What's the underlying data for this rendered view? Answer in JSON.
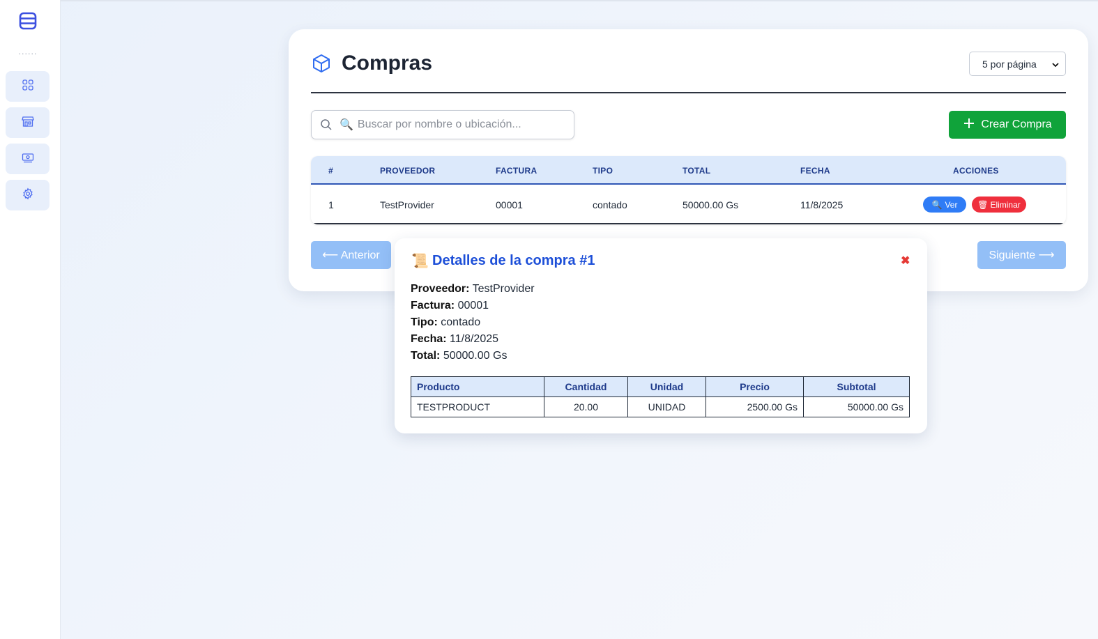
{
  "sidebar": {
    "dots": "......",
    "items": [
      {
        "name": "dashboard"
      },
      {
        "name": "store"
      },
      {
        "name": "cash"
      },
      {
        "name": "settings"
      }
    ]
  },
  "header": {
    "title": "Compras",
    "per_page": "5 por página",
    "per_page_options": [
      "5 por página"
    ]
  },
  "search": {
    "emoji": "🔍",
    "placeholder": "Buscar por nombre o ubicación..."
  },
  "actions": {
    "create_label": "Crear Compra"
  },
  "table": {
    "columns": [
      "#",
      "PROVEEDOR",
      "FACTURA",
      "TIPO",
      "TOTAL",
      "FECHA",
      "ACCIONES"
    ],
    "rows": [
      {
        "num": "1",
        "proveedor": "TestProvider",
        "factura": "00001",
        "tipo": "contado",
        "total": "50000.00 Gs",
        "fecha": "11/8/2025"
      }
    ],
    "ver_label": "Ver",
    "ver_emoji": "🔍",
    "eliminar_label": "Eliminar",
    "eliminar_emoji": "🗑"
  },
  "pagination": {
    "prev_label": "⟵ Anterior",
    "next_label": "Siguiente ⟶"
  },
  "modal": {
    "icon": "📜",
    "title": "Detalles de la compra #1",
    "close": "✖",
    "fields": [
      {
        "label": "Proveedor:",
        "value": "TestProvider"
      },
      {
        "label": "Factura:",
        "value": "00001"
      },
      {
        "label": "Tipo:",
        "value": "contado"
      },
      {
        "label": "Fecha:",
        "value": "11/8/2025"
      },
      {
        "label": "Total:",
        "value": "50000.00 Gs"
      }
    ],
    "table": {
      "columns": [
        "Producto",
        "Cantidad",
        "Unidad",
        "Precio",
        "Subtotal"
      ],
      "rows": [
        {
          "producto": "TESTPRODUCT",
          "cantidad": "20.00",
          "unidad": "UNIDAD",
          "precio": "2500.00 Gs",
          "subtotal": "50000.00 Gs"
        }
      ]
    }
  },
  "colors": {
    "accent": "#1d4fd8",
    "create": "#10a33a",
    "ver": "#2f7cf6",
    "eliminar": "#ef2f3c",
    "pagination": "#93bff7",
    "table_header": "#dce9fb"
  }
}
